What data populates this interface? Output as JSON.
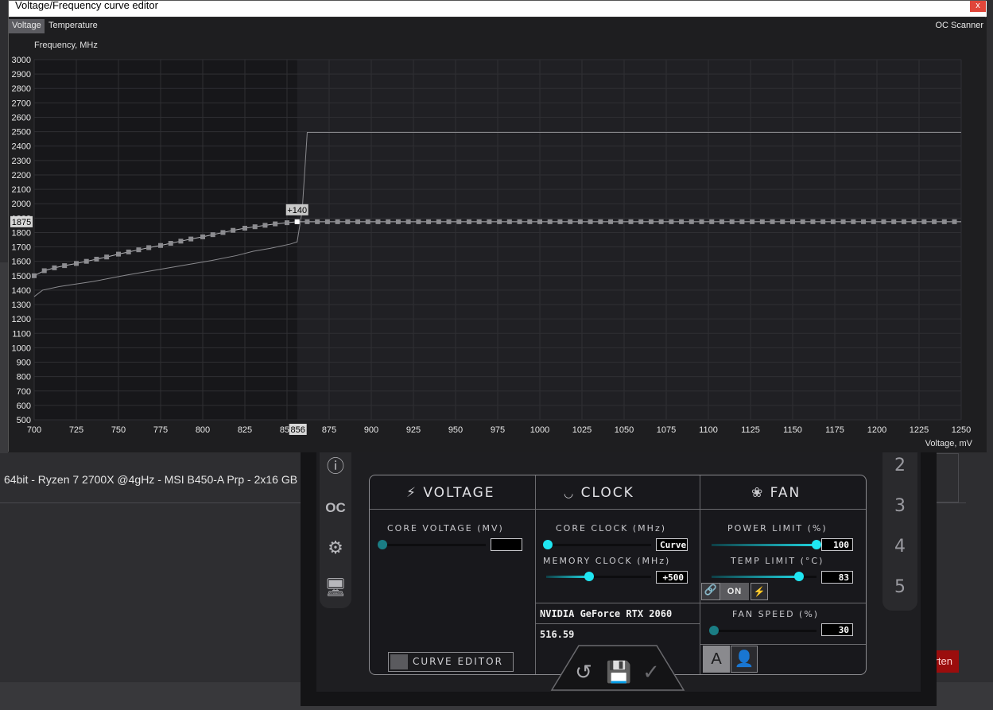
{
  "background": {
    "forum_signature": "64bit - Ryzen 7 2700X @4gHz - MSI B450-A Prp - 2x16 GB",
    "reply_button_label": "Antworten"
  },
  "curve_editor": {
    "window_title": "Voltage/Frequency curve editor",
    "close_glyph": "x",
    "tabs": [
      {
        "label": "Voltage",
        "active": true
      },
      {
        "label": "Temperature",
        "active": false
      }
    ],
    "oc_scanner_label": "OC Scanner",
    "y_axis_title": "Frequency, MHz",
    "x_axis_title": "Voltage, mV",
    "selected_point": {
      "voltage_label": "856",
      "frequency_label": "1875",
      "offset_label": "+140"
    }
  },
  "chart_data": {
    "type": "line",
    "xlabel": "Voltage, mV",
    "ylabel": "Frequency, MHz",
    "xlim": [
      700,
      1250
    ],
    "ylim": [
      500,
      3000
    ],
    "x_ticks": [
      700,
      725,
      750,
      775,
      800,
      825,
      850,
      875,
      900,
      925,
      950,
      975,
      1000,
      1025,
      1050,
      1075,
      1100,
      1125,
      1150,
      1175,
      1200,
      1225,
      1250
    ],
    "y_ticks": [
      500,
      600,
      700,
      800,
      900,
      1000,
      1100,
      1200,
      1300,
      1400,
      1500,
      1600,
      1700,
      1800,
      1900,
      2000,
      2100,
      2200,
      2300,
      2400,
      2500,
      2600,
      2700,
      2800,
      2900,
      3000
    ],
    "grid": true,
    "series": [
      {
        "role": "default-curve",
        "color": "#8a8a8e",
        "x": [
          700,
          705,
          715,
          735,
          755,
          775,
          795,
          805,
          820,
          830,
          840,
          852,
          856,
          859,
          862,
          1250
        ],
        "y": [
          1355,
          1400,
          1425,
          1460,
          1505,
          1545,
          1585,
          1605,
          1640,
          1670,
          1690,
          1720,
          1735,
          1950,
          2495,
          2495
        ]
      },
      {
        "role": "offset-curve-points",
        "color": "#b4b4b8",
        "x": [
          700,
          706,
          712,
          718,
          725,
          731,
          737,
          743,
          750,
          756,
          762,
          768,
          775,
          781,
          787,
          793,
          800,
          806,
          812,
          818,
          825,
          831,
          837,
          843,
          850,
          856
        ],
        "y": [
          1500,
          1535,
          1555,
          1570,
          1585,
          1600,
          1615,
          1630,
          1650,
          1665,
          1680,
          1695,
          1710,
          1725,
          1740,
          1755,
          1770,
          1785,
          1800,
          1815,
          1830,
          1840,
          1850,
          1860,
          1868,
          1875
        ]
      },
      {
        "role": "flat-segment",
        "color": "#b4b4b8",
        "x_start": 856,
        "x_end": 1250,
        "point_step": 6,
        "y": 1875
      }
    ]
  },
  "afterburner": {
    "sections": {
      "voltage_title": "VOLTAGE",
      "clock_title": "CLOCK",
      "fan_title": "FAN"
    },
    "core_voltage": {
      "label": "CORE VOLTAGE  (MV)",
      "value": "",
      "level": 0
    },
    "core_clock": {
      "label": "CORE CLOCK (MHz)",
      "value": "Curve",
      "level": 0
    },
    "memory_clock": {
      "label": "MEMORY CLOCK (MHz)",
      "value": "+500",
      "level": 0.45
    },
    "power_limit": {
      "label": "POWER LIMIT (%)",
      "value": "100",
      "level": 1.0
    },
    "temp_limit": {
      "label": "TEMP LIMIT (°C)",
      "value": "83",
      "level": 0.85
    },
    "fan_speed": {
      "label": "FAN SPEED (%)",
      "value": "30",
      "level": 0
    },
    "link_state": "ON",
    "gpu_name": "NVIDIA GeForce RTX 2060",
    "driver_version": "516.59",
    "curve_editor_button": "CURVE EDITOR",
    "auto_button": "A",
    "profiles": [
      "2",
      "3",
      "4",
      "5"
    ]
  },
  "colors": {
    "accent": "#1fe6f2",
    "close_red": "#e0463a",
    "reply_red": "#9b0d0d"
  }
}
